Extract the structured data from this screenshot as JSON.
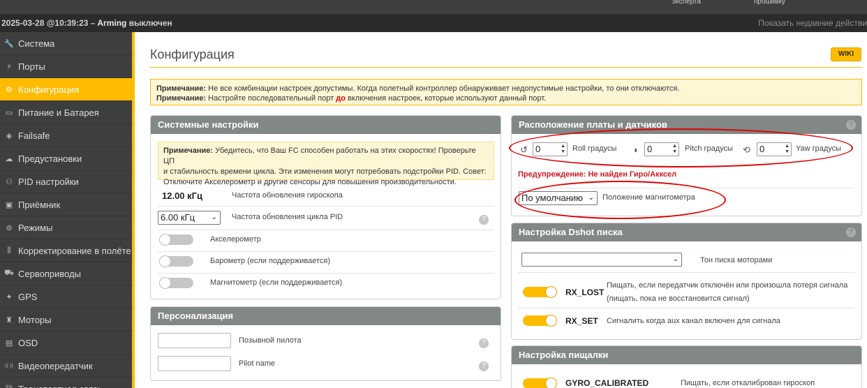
{
  "topbar": {
    "text_left": "эксперта",
    "text_right": "прошивку"
  },
  "status": {
    "datetime": "2025-03-28 @10:39:23 – ",
    "arming": "Arming",
    "arming_state": " выключен",
    "recent_actions": "Показать недавние действи"
  },
  "sidebar": {
    "items": [
      {
        "label": "Система",
        "icon": "wrench-icon"
      },
      {
        "label": "Порты",
        "icon": "plug-icon"
      },
      {
        "label": "Конфигурация",
        "icon": "gear-icon"
      },
      {
        "label": "Питание и Батарея",
        "icon": "battery-icon"
      },
      {
        "label": "Failsafe",
        "icon": "shield-icon"
      },
      {
        "label": "Предустановки",
        "icon": "preset-icon"
      },
      {
        "label": "PID настройки",
        "icon": "pid-icon"
      },
      {
        "label": "Приёмник",
        "icon": "receiver-icon"
      },
      {
        "label": "Режимы",
        "icon": "modes-icon"
      },
      {
        "label": "Корректирование в полёте",
        "icon": "sliders-icon"
      },
      {
        "label": "Сервоприводы",
        "icon": "servo-icon"
      },
      {
        "label": "GPS",
        "icon": "satellite-icon"
      },
      {
        "label": "Моторы",
        "icon": "motor-icon"
      },
      {
        "label": "OSD",
        "icon": "osd-icon"
      },
      {
        "label": "Видеопередатчик",
        "icon": "antenna-icon"
      },
      {
        "label": "Транспортная связь",
        "icon": "link-icon"
      }
    ]
  },
  "page": {
    "title": "Конфигурация",
    "wiki": "WIKI",
    "note1_b": "Примечание:",
    "note1": " Не все комбинации настроек допустимы. Когда полетный контроллер обнаруживает недопустимые настройки, то они отключаются.",
    "note2_b": "Примечание:",
    "note2_a": " Настройте последовательный порт ",
    "note2_red": "до",
    "note2_c": " включения настроек, которые используют данный порт."
  },
  "system": {
    "title": "Системные настройки",
    "note_b": "Примечание:",
    "note_line1": " Убедитесь, что Ваш FC способен работать на этих скоростях! Проверьте ЦП",
    "note_line2": "и стабильность времени цикла. Эти изменения могут потребовать подстройки PID. Совет:",
    "note_line3": "Отключите Акселерометр и другие сенсоры для повышения производительности.",
    "gyro_freq": "12.00 кГц",
    "gyro_label": "Частота обновления гироскопа",
    "pid_freq": "6.00 кГц",
    "pid_label": "Частота обновления цикла PID",
    "accel": "Акселерометр",
    "baro": "Барометр (если поддерживается)",
    "mag": "Магнитометр (если поддерживается)"
  },
  "personal": {
    "title": "Персонализация",
    "callsign": "Позывной пилота",
    "pilotname": "Pilot name"
  },
  "board": {
    "title": "Расположение платы и датчиков",
    "roll_val": "0",
    "roll_label": "Roll градусы",
    "pitch_val": "0",
    "pitch_label": "Pitch градусы",
    "yaw_val": "0",
    "yaw_label": "Yaw градусы",
    "warning": "Предупреждение: Не найден Гиро/Акксел",
    "mag_select": "По умолчанию",
    "mag_label": "Положение магнитометра"
  },
  "dshot": {
    "title": "Настройка Dshot писка",
    "tone_label": "Тон писка моторами",
    "rxlost": "RX_LOST",
    "rxlost_desc1": "Пищать, если передатчик отключён или произошла потеря сигнала",
    "rxlost_desc2": "(пищать, пока не восстановится сигнал)",
    "rxset": "RX_SET",
    "rxset_desc": "Сигналить когда aux канал включен для сигнала"
  },
  "beeper": {
    "title": "Настройка пищалки",
    "gyro": "GYRO_CALIBRATED",
    "gyro_desc": "Пищать, если откалиброван гироскоп"
  },
  "colors": {
    "accent": "#ffbb00",
    "panel_head": "#828885",
    "sidebar": "#3d3f3e",
    "warning": "#d0181f"
  }
}
